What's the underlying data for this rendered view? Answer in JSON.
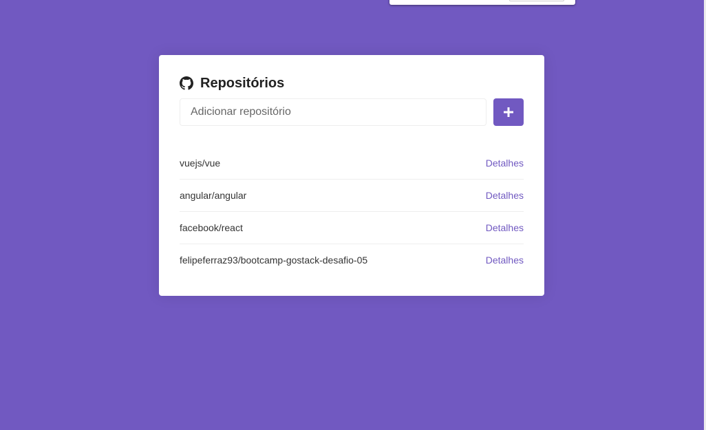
{
  "colors": {
    "background": "#7159c1",
    "accent": "#7159c1",
    "card": "#ffffff"
  },
  "card": {
    "title": "Repositórios",
    "title_icon": "github-icon"
  },
  "form": {
    "placeholder": "Adicionar repositório",
    "value": "",
    "add_button_icon": "plus-icon"
  },
  "repositories": [
    {
      "name": "vuejs/vue",
      "link": "Detalhes"
    },
    {
      "name": "angular/angular",
      "link": "Detalhes"
    },
    {
      "name": "facebook/react",
      "link": "Detalhes"
    },
    {
      "name": "felipeferraz93/bootcamp-gostack-desafio-05",
      "link": "Detalhes"
    }
  ]
}
